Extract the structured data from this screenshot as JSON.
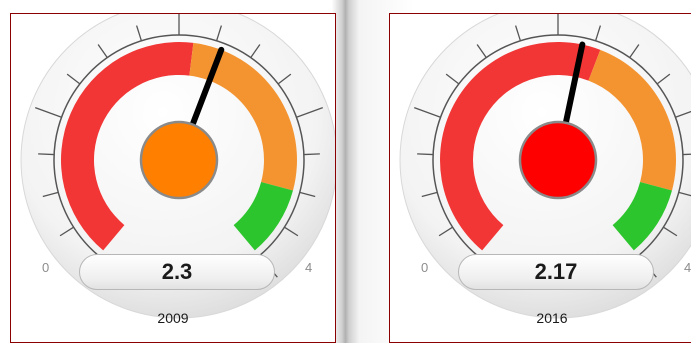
{
  "chart_data": [
    {
      "type": "gauge",
      "min": 0,
      "max": 4,
      "min_label": "0",
      "max_label": "4",
      "value": 2.3,
      "value_label": "2.3",
      "year": "2009",
      "bands": [
        {
          "from": 0,
          "to": 2.1,
          "color": "#f23535"
        },
        {
          "from": 2.1,
          "to": 3.5,
          "color": "#f49431"
        },
        {
          "from": 3.5,
          "to": 4,
          "color": "#2dc52d"
        }
      ],
      "center_color": "#ff8000"
    },
    {
      "type": "gauge",
      "min": 0,
      "max": 4,
      "min_label": "0",
      "max_label": "4",
      "value": 2.17,
      "value_label": "2.17",
      "year": "2016",
      "bands": [
        {
          "from": 0,
          "to": 2.3,
          "color": "#f23535"
        },
        {
          "from": 2.3,
          "to": 3.5,
          "color": "#f49431"
        },
        {
          "from": 3.5,
          "to": 4,
          "color": "#2dc52d"
        }
      ],
      "center_color": "#ff0000"
    }
  ]
}
